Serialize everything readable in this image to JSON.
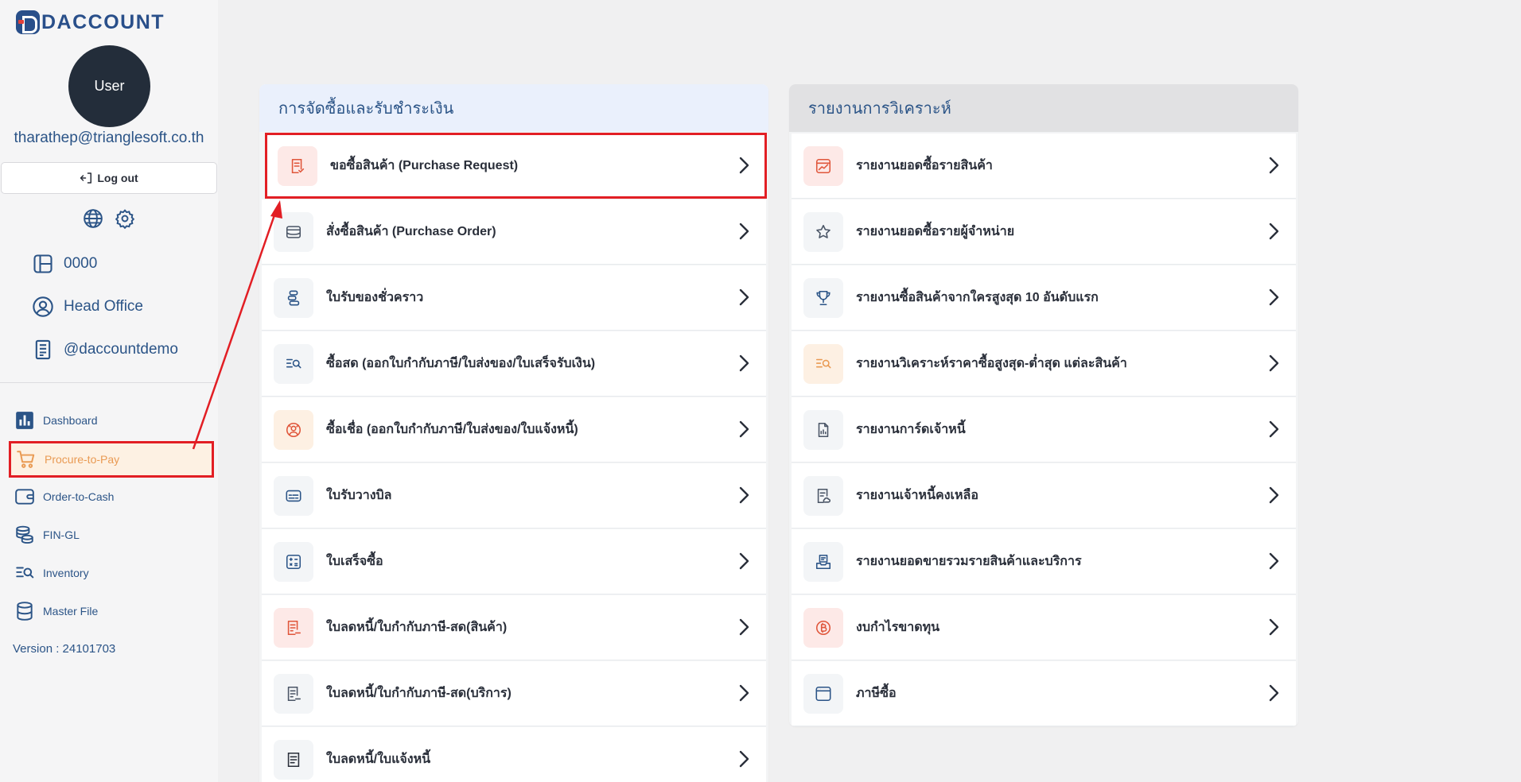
{
  "app": {
    "logo_text": "DACCOUNT"
  },
  "user": {
    "avatar_label": "User",
    "email": "tharathep@trianglesoft.co.th",
    "logout_label": "Log out"
  },
  "info": [
    {
      "label": "0000",
      "icon": "layout-icon"
    },
    {
      "label": "Head Office",
      "icon": "user-circle-icon"
    },
    {
      "label": "@daccountdemo",
      "icon": "document-icon"
    }
  ],
  "nav": [
    {
      "label": "Dashboard",
      "icon": "bar-chart-icon"
    },
    {
      "label": "Procure-to-Pay",
      "icon": "cart-icon",
      "active": true
    },
    {
      "label": "Order-to-Cash",
      "icon": "wallet-icon"
    },
    {
      "label": "FIN-GL",
      "icon": "coins-icon"
    },
    {
      "label": "Inventory",
      "icon": "list-search-icon"
    },
    {
      "label": "Master File",
      "icon": "database-icon"
    }
  ],
  "version": "Version : 24101703",
  "left_panel": {
    "title": "การจัดซื้อและรับชำระเงิน",
    "items": [
      {
        "label": "ขอซื้อสินค้า (Purchase Request)",
        "icon": "receipt-check-icon"
      },
      {
        "label": "สั่งซื้อสินค้า (Purchase Order)",
        "icon": "wallet-card-icon"
      },
      {
        "label": "ใบรับของชั่วคราว",
        "icon": "boxes-icon"
      },
      {
        "label": "ซื้อสด (ออกใบกำกับภาษี/ใบส่งของ/ใบเสร็จรับเงิน)",
        "icon": "list-search-icon"
      },
      {
        "label": "ซื้อเชื่อ (ออกใบกำกับภาษี/ใบส่งของ/ใบแจ้งหนี้)",
        "icon": "coin-hand-icon"
      },
      {
        "label": "ใบรับวางบิล",
        "icon": "card-icon"
      },
      {
        "label": "ใบเสร็จซื้อ",
        "icon": "calculator-icon"
      },
      {
        "label": "ใบลดหนี้/ใบกำกับภาษี-สด(สินค้า)",
        "icon": "receipt-minus-icon"
      },
      {
        "label": "ใบลดหนี้/ใบกำกับภาษี-สด(บริการ)",
        "icon": "receipt-minus-icon"
      },
      {
        "label": "ใบลดหนี้/ใบแจ้งหนี้",
        "icon": "receipt-icon"
      }
    ]
  },
  "right_panel": {
    "title": "รายงานการวิเคราะห์",
    "items": [
      {
        "label": "รายงานยอดซื้อรายสินค้า",
        "icon": "chart-line-icon"
      },
      {
        "label": "รายงานยอดซื้อรายผู้จำหน่าย",
        "icon": "star-icon"
      },
      {
        "label": "รายงานซื้อสินค้าจากใครสูงสุด 10 อันดับแรก",
        "icon": "trophy-icon"
      },
      {
        "label": "รายงานวิเคราะห์ราคาซื้อสูงสุด-ต่ำสุด แต่ละสินค้า",
        "icon": "list-search-icon"
      },
      {
        "label": "รายงานการ์ดเจ้าหนี้",
        "icon": "file-chart-icon"
      },
      {
        "label": "รายงานเจ้าหนี้คงเหลือ",
        "icon": "receipt-cloud-icon"
      },
      {
        "label": "รายงานยอดขายรวมรายสินค้าและบริการ",
        "icon": "tray-icon"
      },
      {
        "label": "งบกำไรขาดทุน",
        "icon": "bitcoin-icon"
      },
      {
        "label": "ภาษีซื้อ",
        "icon": "browser-icon"
      }
    ]
  },
  "colors": {
    "primary": "#2b5487",
    "active": "#e99a53",
    "highlight": "#e21e24"
  }
}
